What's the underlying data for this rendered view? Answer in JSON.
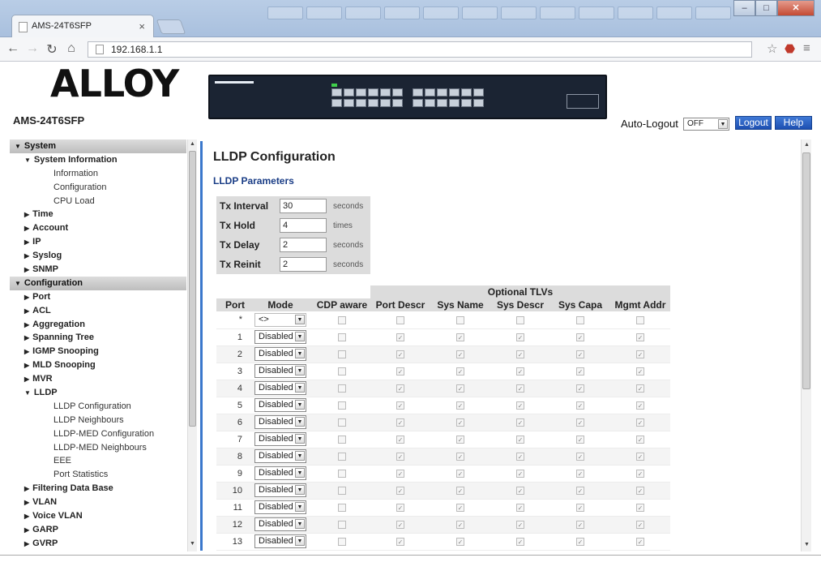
{
  "browser": {
    "tab_title": "AMS-24T6SFP",
    "url": "192.168.1.1"
  },
  "header": {
    "logo": "ALLOY",
    "model": "AMS-24T6SFP",
    "auto_logout_label": "Auto-Logout",
    "auto_logout_value": "OFF",
    "logout_label": "Logout",
    "help_label": "Help"
  },
  "sidebar": {
    "items": [
      {
        "label": "System",
        "level": "top",
        "icon": "triangle-down-icon"
      },
      {
        "label": "System Information",
        "level": "sub",
        "icon": "triangle-down-icon"
      },
      {
        "label": "Information",
        "level": "leaf"
      },
      {
        "label": "Configuration",
        "level": "leaf"
      },
      {
        "label": "CPU Load",
        "level": "leaf"
      },
      {
        "label": "Time",
        "level": "sub",
        "icon": "triangle-right-icon"
      },
      {
        "label": "Account",
        "level": "sub",
        "icon": "triangle-right-icon"
      },
      {
        "label": "IP",
        "level": "sub",
        "icon": "triangle-right-icon"
      },
      {
        "label": "Syslog",
        "level": "sub",
        "icon": "triangle-right-icon"
      },
      {
        "label": "SNMP",
        "level": "sub",
        "icon": "triangle-right-icon"
      },
      {
        "label": "Configuration",
        "level": "top",
        "icon": "triangle-down-icon"
      },
      {
        "label": "Port",
        "level": "sub",
        "icon": "triangle-right-icon"
      },
      {
        "label": "ACL",
        "level": "sub",
        "icon": "triangle-right-icon"
      },
      {
        "label": "Aggregation",
        "level": "sub",
        "icon": "triangle-right-icon"
      },
      {
        "label": "Spanning Tree",
        "level": "sub",
        "icon": "triangle-right-icon"
      },
      {
        "label": "IGMP Snooping",
        "level": "sub",
        "icon": "triangle-right-icon"
      },
      {
        "label": "MLD Snooping",
        "level": "sub",
        "icon": "triangle-right-icon"
      },
      {
        "label": "MVR",
        "level": "sub",
        "icon": "triangle-right-icon"
      },
      {
        "label": "LLDP",
        "level": "sub",
        "icon": "triangle-down-icon"
      },
      {
        "label": "LLDP Configuration",
        "level": "leaf"
      },
      {
        "label": "LLDP Neighbours",
        "level": "leaf"
      },
      {
        "label": "LLDP-MED Configuration",
        "level": "leaf"
      },
      {
        "label": "LLDP-MED Neighbours",
        "level": "leaf"
      },
      {
        "label": "EEE",
        "level": "leaf"
      },
      {
        "label": "Port Statistics",
        "level": "leaf"
      },
      {
        "label": "Filtering Data Base",
        "level": "sub",
        "icon": "triangle-right-icon"
      },
      {
        "label": "VLAN",
        "level": "sub",
        "icon": "triangle-right-icon"
      },
      {
        "label": "Voice VLAN",
        "level": "sub",
        "icon": "triangle-right-icon"
      },
      {
        "label": "GARP",
        "level": "sub",
        "icon": "triangle-right-icon"
      },
      {
        "label": "GVRP",
        "level": "sub",
        "icon": "triangle-right-icon"
      }
    ]
  },
  "main": {
    "title": "LLDP Configuration",
    "params_heading": "LLDP Parameters",
    "params": [
      {
        "label": "Tx Interval",
        "value": "30",
        "unit": "seconds"
      },
      {
        "label": "Tx Hold",
        "value": "4",
        "unit": "times"
      },
      {
        "label": "Tx Delay",
        "value": "2",
        "unit": "seconds"
      },
      {
        "label": "Tx Reinit",
        "value": "2",
        "unit": "seconds"
      }
    ],
    "table": {
      "group_header": "Optional TLVs",
      "headers": [
        "Port",
        "Mode",
        "CDP aware",
        "Port Descr",
        "Sys Name",
        "Sys Descr",
        "Sys Capa",
        "Mgmt Addr"
      ],
      "wildcard_row": {
        "port": "*",
        "mode": "<>"
      },
      "rows": [
        {
          "port": "1",
          "mode": "Disabled"
        },
        {
          "port": "2",
          "mode": "Disabled"
        },
        {
          "port": "3",
          "mode": "Disabled"
        },
        {
          "port": "4",
          "mode": "Disabled"
        },
        {
          "port": "5",
          "mode": "Disabled"
        },
        {
          "port": "6",
          "mode": "Disabled"
        },
        {
          "port": "7",
          "mode": "Disabled"
        },
        {
          "port": "8",
          "mode": "Disabled"
        },
        {
          "port": "9",
          "mode": "Disabled"
        },
        {
          "port": "10",
          "mode": "Disabled"
        },
        {
          "port": "11",
          "mode": "Disabled"
        },
        {
          "port": "12",
          "mode": "Disabled"
        },
        {
          "port": "13",
          "mode": "Disabled"
        }
      ]
    }
  }
}
